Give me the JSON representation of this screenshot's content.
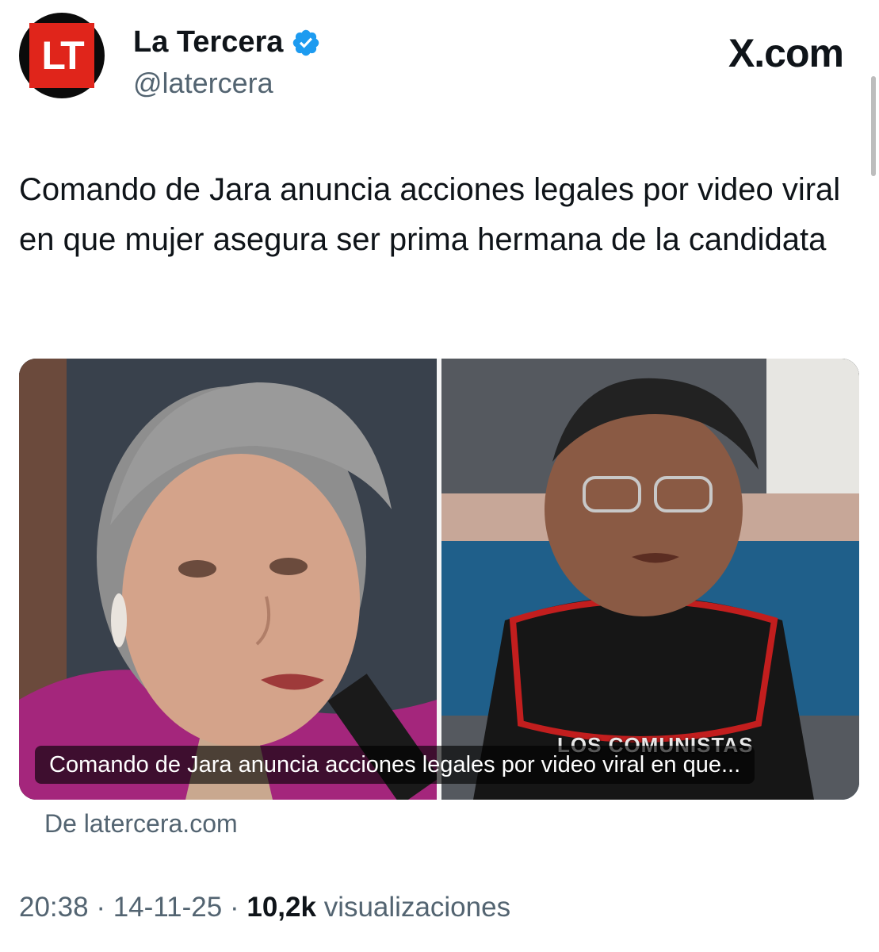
{
  "account": {
    "avatar_text": "LT",
    "name": "La Tercera",
    "handle": "@latercera",
    "verified": true,
    "verified_icon": "verified-badge-icon",
    "verified_color": "#1d9bf0",
    "brand_color": "#e0251b"
  },
  "site_label": "X.com",
  "tweet": {
    "text": "Comando de Jara anuncia acciones legales por video viral en que mujer asegura ser prima hermana de la candidata"
  },
  "link_card": {
    "caption": "Comando de Jara anuncia acciones legales por video viral en que...",
    "video_overlay_text": "LOS COMUNISTAS",
    "source": "De latercera.com"
  },
  "meta": {
    "time": "20:38",
    "date": "14-11-25",
    "separator": "·",
    "views_count": "10,2k",
    "views_label": "visualizaciones"
  }
}
